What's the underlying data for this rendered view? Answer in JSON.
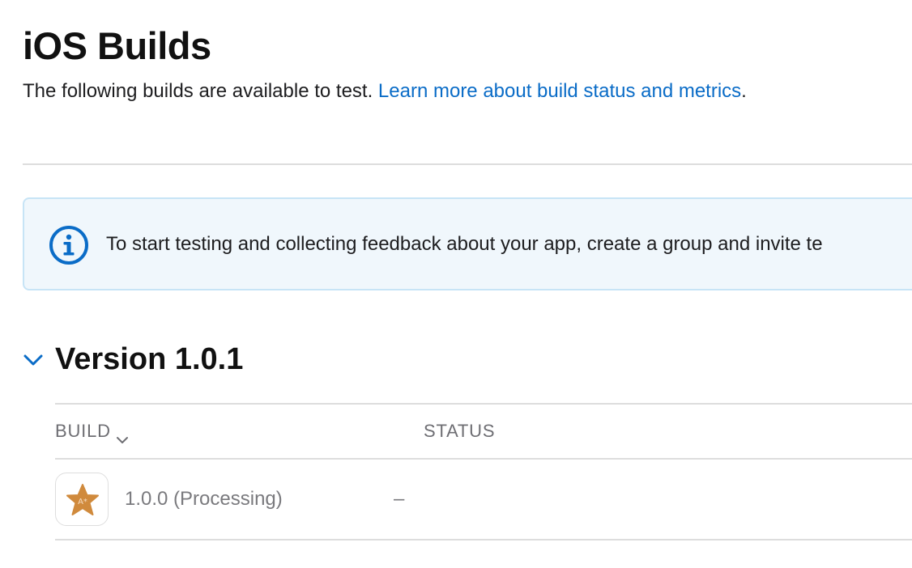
{
  "header": {
    "title": "iOS Builds",
    "intro_text": "The following builds are available to test.",
    "intro_link": "Learn more about build status and metrics",
    "intro_period": "."
  },
  "banner": {
    "icon": "info-circle-icon",
    "text": "To start testing and collecting feedback about your app, create a group and invite te"
  },
  "version_section": {
    "toggle_icon": "chevron-down-icon",
    "title": "Version 1.0.1",
    "table": {
      "columns": [
        "BUILD",
        "STATUS"
      ],
      "rows": [
        {
          "icon": "app-star-icon",
          "build": "1.0.0 (Processing)",
          "status": "–"
        }
      ]
    }
  },
  "colors": {
    "link": "#0a6cc7",
    "banner_bg": "#f0f7fc",
    "banner_border": "#c7e4f6",
    "app_icon_star": "#d08a3c"
  }
}
